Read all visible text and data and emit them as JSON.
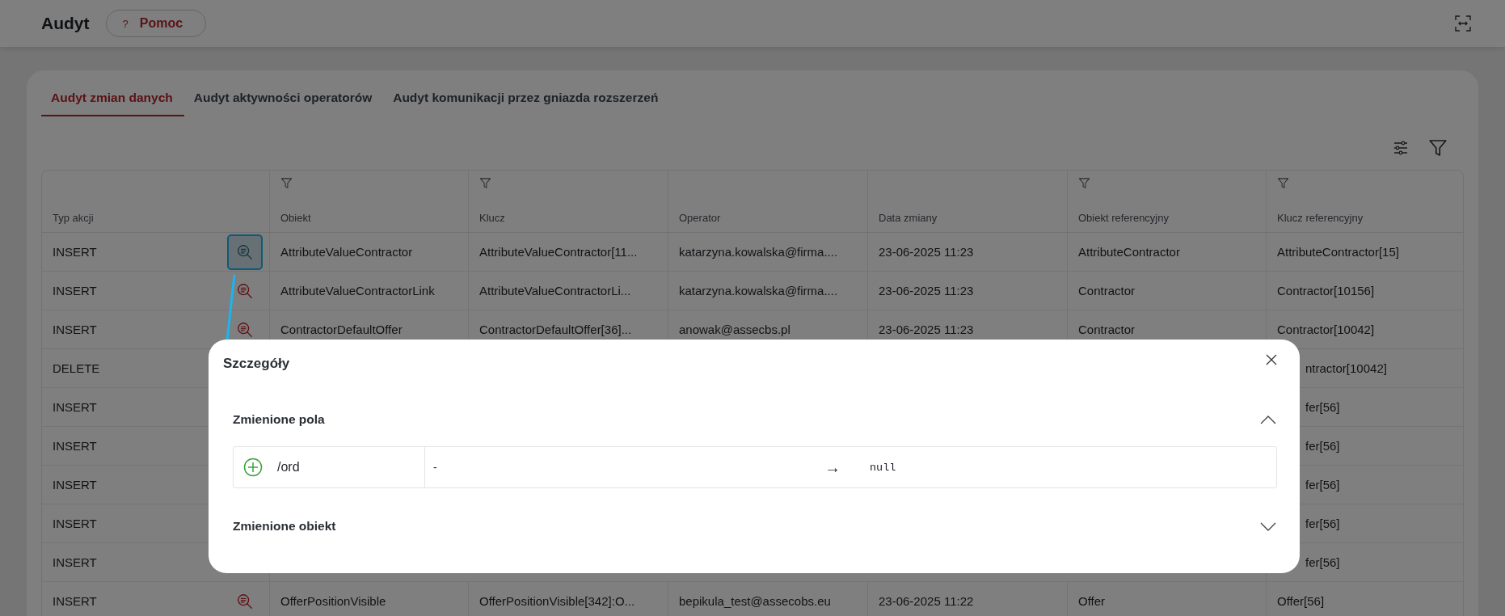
{
  "header": {
    "title": "Audyt",
    "help_button": {
      "icon": "?",
      "label": "Pomoc"
    }
  },
  "tabs": [
    {
      "label": "Audyt zmian danych",
      "selected": true
    },
    {
      "label": "Audyt aktywności operatorów",
      "selected": false
    },
    {
      "label": "Audyt komunikacji przez gniazda rozszerzeń",
      "selected": false
    }
  ],
  "table": {
    "columns": [
      {
        "label": "Typ akcji",
        "filter": false
      },
      {
        "label": "Obiekt",
        "filter": true
      },
      {
        "label": "Klucz",
        "filter": true
      },
      {
        "label": "Operator",
        "filter": false
      },
      {
        "label": "Data zmiany",
        "filter": false
      },
      {
        "label": "Obiekt referencyjny",
        "filter": true
      },
      {
        "label": "Klucz referencyjny",
        "filter": true
      }
    ],
    "rows": [
      {
        "action": "INSERT",
        "selected": true,
        "cells": [
          "AttributeValueContractor",
          "AttributeValueContractor[11...",
          "katarzyna.kowalska@firma....",
          "23-06-2025 11:23",
          "AttributeContractor",
          "AttributeContractor[15]"
        ]
      },
      {
        "action": "INSERT",
        "selected": false,
        "cells": [
          "AttributeValueContractorLink",
          "AttributeValueContractorLi...",
          "katarzyna.kowalska@firma....",
          "23-06-2025 11:23",
          "Contractor",
          "Contractor[10156]"
        ]
      },
      {
        "action": "INSERT",
        "selected": false,
        "cells": [
          "ContractorDefaultOffer",
          "ContractorDefaultOffer[36]...",
          "anowak@assecbs.pl",
          "23-06-2025 11:23",
          "Contractor",
          "Contractor[10042]"
        ]
      },
      {
        "action": "DELETE",
        "edge": "ntractor[10042]"
      },
      {
        "action": "INSERT",
        "edge": "fer[56]"
      },
      {
        "action": "INSERT",
        "edge": "fer[56]"
      },
      {
        "action": "INSERT",
        "edge": "fer[56]"
      },
      {
        "action": "INSERT",
        "edge": "fer[56]"
      },
      {
        "action": "INSERT",
        "edge": "fer[56]"
      },
      {
        "action": "INSERT",
        "selected": false,
        "cells": [
          "OfferPositionVisible",
          "OfferPositionVisible[342]:O...",
          "bepikula_test@assecobs.eu",
          "23-06-2025 11:22",
          "Offer",
          "Offer[56]"
        ]
      }
    ]
  },
  "dialog": {
    "title": "Szczegóły",
    "sections": [
      {
        "title": "Zmienione pola",
        "expanded": true,
        "changes": [
          {
            "kind": "added",
            "path": "/ord",
            "old": "-",
            "arrow": "→",
            "new": "null"
          }
        ]
      },
      {
        "title": "Zmienione obiekt",
        "expanded": false
      }
    ]
  }
}
